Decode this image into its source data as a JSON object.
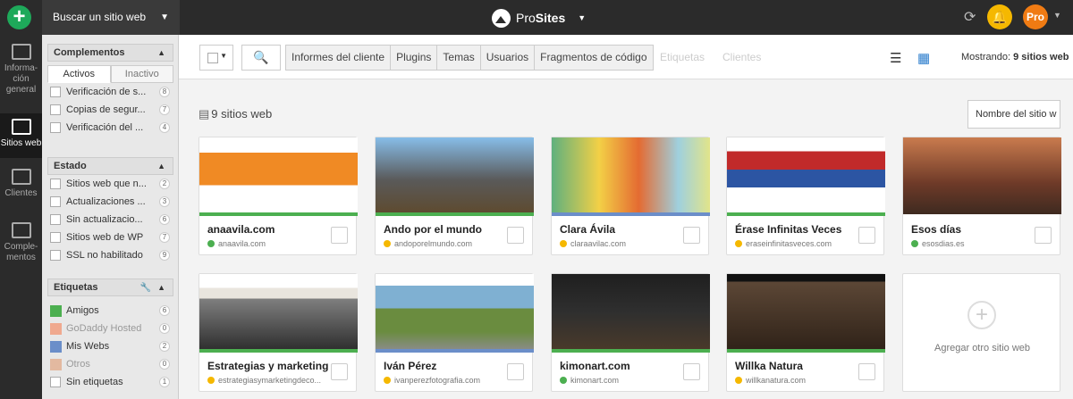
{
  "topbar": {
    "add_label": "+",
    "site_search_label": "Buscar un sitio web",
    "brand_pro": "Pro",
    "brand_sites": "Sites",
    "user_badge": "Pro"
  },
  "leftnav": [
    {
      "label": "Informa-ción general",
      "icon": "overview-icon"
    },
    {
      "label": "Sitios web",
      "icon": "sites-icon"
    },
    {
      "label": "Clientes",
      "icon": "clients-icon"
    },
    {
      "label": "Comple-mentos",
      "icon": "plugins-icon"
    }
  ],
  "sidebar": {
    "complementos": {
      "title": "Complementos",
      "tab_active": "Activos",
      "tab_inactive": "Inactivo",
      "items": [
        {
          "label": "Verificación de s...",
          "count": "8"
        },
        {
          "label": "Copias de segur...",
          "count": "7"
        },
        {
          "label": "Verificación del ...",
          "count": "4"
        }
      ]
    },
    "estado": {
      "title": "Estado",
      "items": [
        {
          "label": "Sitios web que n...",
          "count": "2"
        },
        {
          "label": "Actualizaciones ...",
          "count": "3"
        },
        {
          "label": "Sin actualizacio...",
          "count": "6"
        },
        {
          "label": "Sitios web de WP",
          "count": "7"
        },
        {
          "label": "SSL no habilitado",
          "count": "9"
        }
      ]
    },
    "etiquetas": {
      "title": "Etiquetas",
      "items": [
        {
          "label": "Amigos",
          "count": "6",
          "color": "#4caf50"
        },
        {
          "label": "GoDaddy Hosted",
          "count": "0",
          "color": "#f0a98f"
        },
        {
          "label": "Mis Webs",
          "count": "2",
          "color": "#6b8ec9"
        },
        {
          "label": "Otros",
          "count": "0",
          "color": "#e3b9a0"
        },
        {
          "label": "Sin etiquetas",
          "count": "1"
        }
      ]
    }
  },
  "toolbar": {
    "filters": [
      "Informes del cliente",
      "Plugins",
      "Temas",
      "Usuarios",
      "Fragmentos de código"
    ],
    "disabled": [
      "Etiquetas",
      "Clientes"
    ],
    "showing_prefix": "Mostrando:",
    "showing_value": "9 sitios web"
  },
  "main": {
    "count_label": "9 sitios web",
    "sort_label": "Nombre del sitio w"
  },
  "sites": [
    {
      "name": "anaavila.com",
      "url": "anaavila.com",
      "status_color": "#4caf50",
      "url_icon": "globe-icon",
      "bar": "#4caf50"
    },
    {
      "name": "Ando por el mundo",
      "url": "andoporelmundo.com",
      "status_color": "#f5b800",
      "url_icon": "wordpress-icon",
      "bar": "#4caf50"
    },
    {
      "name": "Clara Ávila",
      "url": "claraavilac.com",
      "status_color": "#f5b800",
      "url_icon": "wordpress-icon",
      "bar": "#6b8ec9"
    },
    {
      "name": "Érase Infinitas Veces",
      "url": "eraseinfinitasveces.com",
      "status_color": "#f5b800",
      "url_icon": "wordpress-icon",
      "bar": "#4caf50"
    },
    {
      "name": "Esos días",
      "url": "esosdias.es",
      "status_color": "#4caf50",
      "url_icon": "wordpress-icon",
      "bar": ""
    },
    {
      "name": "Estrategias y marketing d...",
      "url": "estrategiasymarketingdeco...",
      "status_color": "#f5b800",
      "url_icon": "wordpress-icon",
      "bar": "#4caf50"
    },
    {
      "name": "Iván Pérez",
      "url": "ivanperezfotografia.com",
      "status_color": "#f5b800",
      "url_icon": "wordpress-icon",
      "bar": "#6b8ec9"
    },
    {
      "name": "kimonart.com",
      "url": "kimonart.com",
      "status_color": "#4caf50",
      "url_icon": "globe-icon",
      "bar": "#4caf50"
    },
    {
      "name": "Willka Natura",
      "url": "willkanatura.com",
      "status_color": "#f5b800",
      "url_icon": "wordpress-icon",
      "bar": "#4caf50"
    }
  ],
  "add_site": {
    "label": "Agregar otro sitio web"
  }
}
